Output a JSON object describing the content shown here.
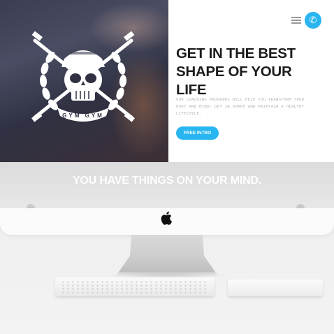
{
  "hero": {
    "headline": "GET IN THE BEST\nSHAPE OF YOUR\nLIFE",
    "body": "OUR COACHING PROGRAMS WILL HELP YOU TRANSFORM YOUR BODY AND MIND! GET IN SHAPE AND MAINTAIN A HEALTHY LIFESTYLE.",
    "cta_label": "FREE INTRO",
    "logo_text": "GYM GYM"
  },
  "header": {
    "menu_icon": "hamburger-menu-icon",
    "phone_icon": "phone-icon"
  },
  "band": {
    "text": "YOU HAVE THINGS ON YOUR MIND."
  },
  "device": {
    "brand_icon": "apple-logo-icon"
  },
  "colors": {
    "accent": "#29b6f0",
    "headline": "#1c1c1c",
    "body": "#b9b9b9",
    "band_text": "#ffffff"
  }
}
